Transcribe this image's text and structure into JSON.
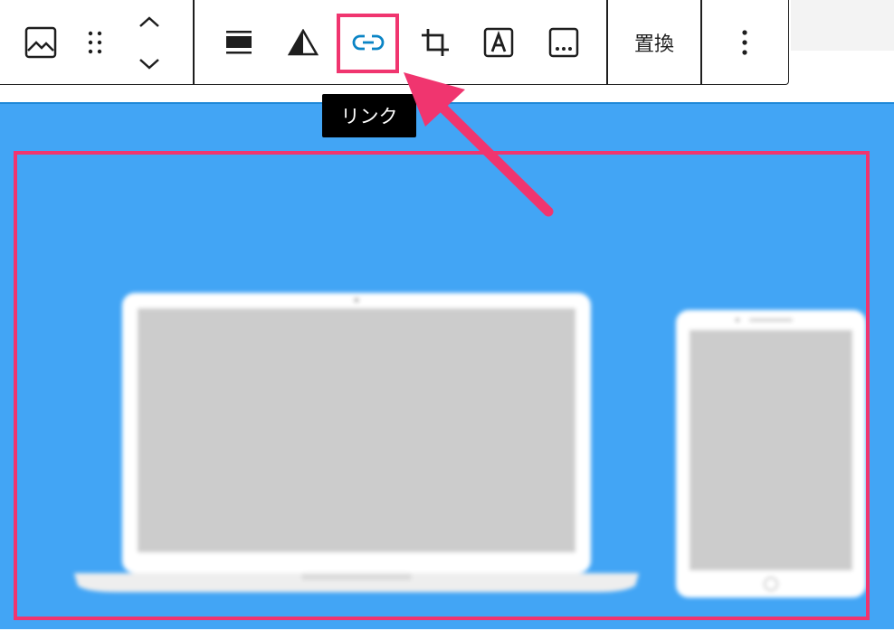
{
  "toolbar": {
    "buttons": [
      {
        "icon": "image-icon"
      },
      {
        "icon": "drag-handle-icon"
      },
      {
        "icon": "move-up-icon"
      },
      {
        "icon": "move-down-icon"
      },
      {
        "icon": "align-icon"
      },
      {
        "icon": "duotone-icon"
      },
      {
        "icon": "link-icon"
      },
      {
        "icon": "crop-icon"
      },
      {
        "icon": "text-overlay-icon"
      },
      {
        "icon": "alt-text-icon"
      },
      {
        "icon": "more-options-icon"
      }
    ],
    "replace_label": "置換"
  },
  "tooltip": {
    "text": "リンク"
  },
  "colors": {
    "image_background": "#42a5f5",
    "highlight": "#f0356f",
    "active_icon": "#0a84c5",
    "tooltip_background": "#000000"
  }
}
